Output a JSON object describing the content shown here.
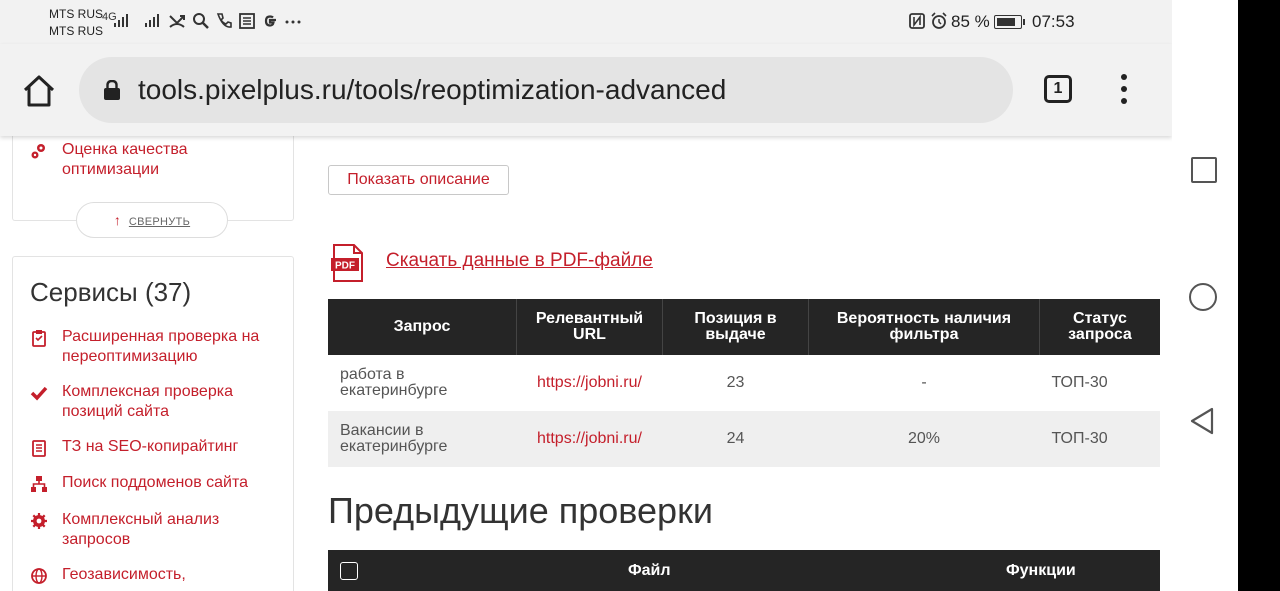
{
  "status": {
    "carrier1": "MTS RUS",
    "carrier2": "MTS RUS",
    "network": "4G",
    "battery": "85 %",
    "time": "07:53"
  },
  "browser": {
    "url": "tools.pixelplus.ru/tools/reoptimization-advanced",
    "tab_count": "1"
  },
  "sidebar": {
    "top_item": "Оценка качества оптимизации",
    "collapse_label": "СВЕРНУТЬ",
    "services_title": "Сервисы (37)",
    "services": [
      {
        "label": "Расширенная проверка на переоптимизацию",
        "icon": "clipboard-icon"
      },
      {
        "label": "Комплексная проверка позиций сайта",
        "icon": "check-icon"
      },
      {
        "label": "ТЗ на SEO-копирайтинг",
        "icon": "document-icon"
      },
      {
        "label": "Поиск поддоменов сайта",
        "icon": "sitemap-icon"
      },
      {
        "label": "Комплексный анализ запросов",
        "icon": "gear-icon"
      },
      {
        "label": "Геозависимость,",
        "icon": "globe-icon"
      }
    ]
  },
  "main": {
    "show_description": "Показать описание",
    "pdf_link": "Скачать данные в PDF-файле",
    "table": {
      "headers": [
        "Запрос",
        "Релевантный URL",
        "Позиция в выдаче",
        "Вероятность наличия фильтра",
        "Статус запроса"
      ],
      "rows": [
        [
          "работа в екатеринбурге",
          "https://jobni.ru/",
          "23",
          "-",
          "ТОП-30"
        ],
        [
          "Вакансии в екатеринбурге",
          "https://jobni.ru/",
          "24",
          "20%",
          "ТОП-30"
        ]
      ]
    },
    "previous_title": "Предыдущие проверки",
    "previous_headers": {
      "file": "Файл",
      "functions": "Функции"
    }
  },
  "colors": {
    "accent": "#c41f2b",
    "table_header": "#252525"
  }
}
